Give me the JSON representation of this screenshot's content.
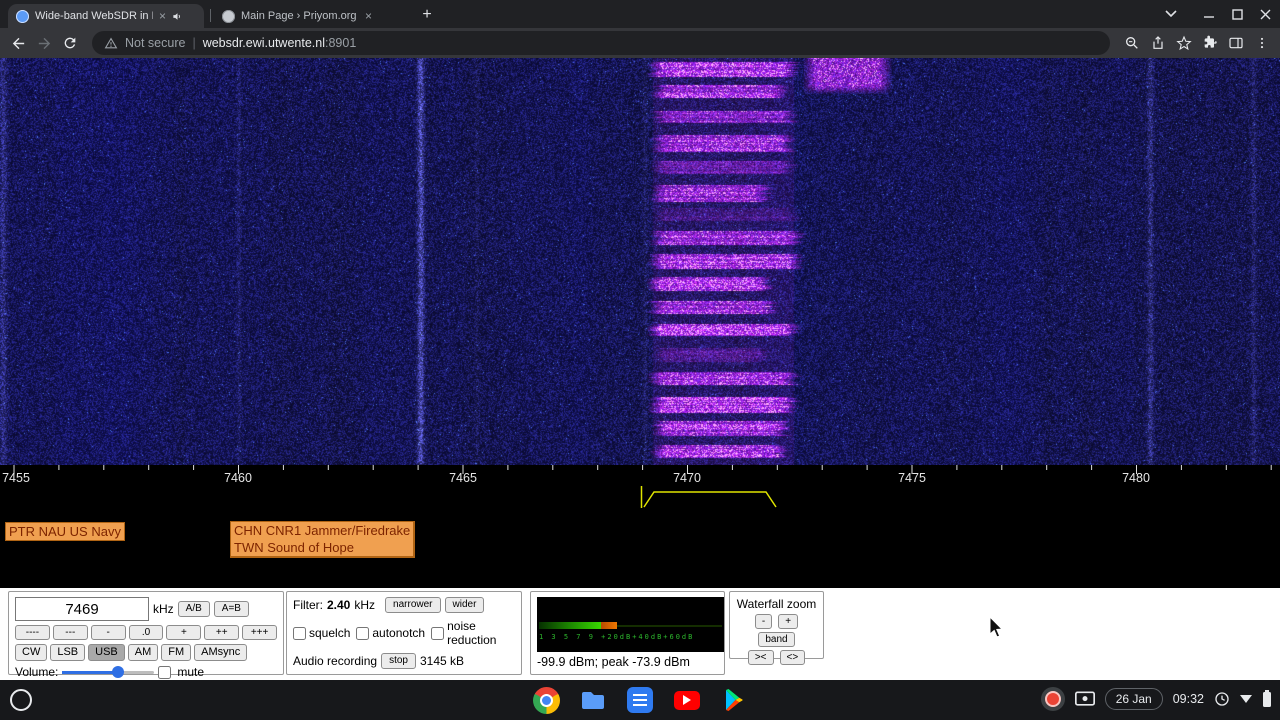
{
  "browser": {
    "tab1": {
      "title": "Wide-band WebSDR in Ensch"
    },
    "tab2": {
      "title": "Main Page › Priyom.org"
    },
    "newtab": "+",
    "address": {
      "security": "Not secure",
      "host": "websdr.ewi.utwente.nl",
      "port": ":8901"
    }
  },
  "waterfall": {
    "band_start_khz": 7454.7,
    "band_end_khz": 7483.2,
    "signal_band": {
      "start_khz": 7469.3,
      "end_khz": 7472.4,
      "description": "Firedrake jammer horizontal bars"
    },
    "carrier_lines_khz": [
      7455.1,
      7460.0,
      7464.1,
      7480.3,
      7482.6
    ]
  },
  "frequency_scale": {
    "labels": [
      "7455",
      "7460",
      "7465",
      "7470",
      "7475",
      "7480"
    ]
  },
  "station_labels": {
    "label1": "PTR NAU US Navy",
    "label2_line1": "CHN CNR1 Jammer/Firedrake",
    "label2_line2": "TWN Sound of Hope"
  },
  "receiver": {
    "frequency": "7469",
    "frequency_unit": "kHz",
    "ab": "A/B",
    "a_eq_b": "A=B",
    "step_buttons": [
      "----",
      "---",
      "-",
      ".0",
      "+",
      "++",
      "+++"
    ],
    "modes": [
      "CW",
      "LSB",
      "USB",
      "AM",
      "FM",
      "AMsync"
    ],
    "active_mode": "USB",
    "volume_label": "Volume:",
    "mute_label": "mute"
  },
  "filter": {
    "label": "Filter:",
    "bandwidth": "2.40",
    "unit": "kHz",
    "narrower": "narrower",
    "wider": "wider",
    "squelch": "squelch",
    "autonotch": "autonotch",
    "noise_reduction": "noise reduction",
    "audio_recording_label": "Audio recording",
    "stop": "stop",
    "recorded_size": "3145 kB"
  },
  "smeter": {
    "scale": "1 3 5 7 9 +20dB+40dB+60dB",
    "reading": "-99.9 dBm; peak  -73.9 dBm"
  },
  "waterfall_zoom": {
    "title": "Waterfall zoom",
    "minus": "-",
    "plus": "+",
    "band": "band",
    "zoom_in": "><",
    "zoom_out": "<>"
  },
  "shelf": {
    "date": "26 Jan",
    "time": "09:32"
  }
}
